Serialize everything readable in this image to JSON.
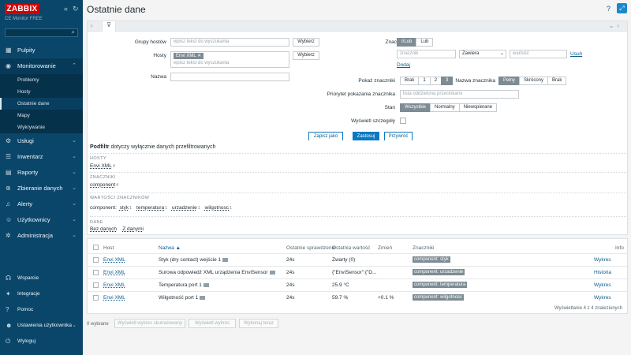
{
  "brand": {
    "logo": "ZABBIX",
    "subtitle": "CE Monitor FREE"
  },
  "sidebar": {
    "items": [
      {
        "label": "Pulpity",
        "icon": "dashboard-icon"
      },
      {
        "label": "Monitorowanie",
        "icon": "eye-icon",
        "open": true
      },
      {
        "label": "Usługi",
        "icon": "services-icon"
      },
      {
        "label": "Inwentarz",
        "icon": "inventory-icon"
      },
      {
        "label": "Raporty",
        "icon": "reports-icon"
      },
      {
        "label": "Zbieranie danych",
        "icon": "data-collection-icon"
      },
      {
        "label": "Alerty",
        "icon": "bell-icon"
      },
      {
        "label": "Użytkownicy",
        "icon": "users-icon"
      },
      {
        "label": "Administracja",
        "icon": "gear-icon"
      }
    ],
    "submenu": [
      {
        "label": "Problemy"
      },
      {
        "label": "Hosty"
      },
      {
        "label": "Ostatnie dane",
        "active": true
      },
      {
        "label": "Mapy"
      },
      {
        "label": "Wykrywanie"
      }
    ],
    "bottom": [
      {
        "label": "Wsparcie"
      },
      {
        "label": "Integracje"
      },
      {
        "label": "Pomoc"
      },
      {
        "label": "Ustawienia użytkownika"
      },
      {
        "label": "Wyloguj"
      }
    ]
  },
  "page": {
    "title": "Ostatnie dane",
    "help": "?"
  },
  "filter": {
    "host_groups_label": "Grupy hostów",
    "host_groups_placeholder": "wpisz tekst do wyszukania",
    "hosts_label": "Hosty",
    "host_chip": "Envi XML",
    "hosts_placeholder": "wpisz tekst do wyszukania",
    "name_label": "Nazwa",
    "select_btn": "Wybierz",
    "tags_label": "Znaczniki",
    "tag_op": [
      "I/Lub",
      "Lub"
    ],
    "tag_placeholder": "znacznik",
    "tag_condition": "Zawiera",
    "tag_value_placeholder": "wartość",
    "remove_link": "Usuń",
    "add_link": "Dodaj",
    "show_tags_label": "Pokaż znaczniki",
    "show_tags_opts": [
      "Brak",
      "1",
      "2",
      "3"
    ],
    "tag_name_label": "Nazwa znacznika",
    "tag_name_opts": [
      "Pełny",
      "Skrócony",
      "Brak"
    ],
    "priority_label": "Priorytet pokazania znacznika",
    "priority_placeholder": "lista oddzielona przecinkami",
    "state_label": "Stan",
    "state_opts": [
      "Wszystkie",
      "Normalny",
      "Niewspierane"
    ],
    "details_label": "Wyświetl szczegóły",
    "save_as": "Zapisz jako",
    "apply": "Zastosuj",
    "reset": "Przywróć"
  },
  "subfilter": {
    "title_bold": "Podfiltr",
    "title_rest": " dotyczy wyłącznie danych przefiltrowanych",
    "hosts_head": "HOSTY",
    "hosts": [
      {
        "name": "Envi XML",
        "count": "4"
      }
    ],
    "tags_head": "ZNACZNIKI",
    "tags": [
      {
        "name": "component",
        "count": "4"
      }
    ],
    "tag_values_head": "WARTOŚCI ZNACZNIKÓW",
    "tag_values_prefix": "component:",
    "tag_values": [
      {
        "name": "styk",
        "count": "1"
      },
      {
        "name": "temperatura",
        "count": "1"
      },
      {
        "name": "urzadzenie",
        "count": "1"
      },
      {
        "name": "wilgotnosc",
        "count": "1"
      }
    ],
    "data_head": "DANE",
    "data": [
      "Bez danych",
      "Z danymi"
    ]
  },
  "table": {
    "headers": {
      "host": "Host",
      "name": "Nazwa ▲",
      "last_check": "Ostatnie sprawdzenie",
      "last_value": "Ostatnia wartość",
      "change": "Zmień",
      "tags": "Znaczniki",
      "info": "Info"
    },
    "rows": [
      {
        "host": "Envi XML",
        "name": "Styk (dry contact) wejście 1",
        "last_check": "24s",
        "last_value": "Zwarty (0)",
        "change": "",
        "tag": "component: styk",
        "action": "Wykres"
      },
      {
        "host": "Envi XML",
        "name": "Surowa odpowiedź XML urządzenia EnviSensor",
        "last_check": "24s",
        "last_value": "{\"EnviSensor\":{\"D...",
        "change": "",
        "tag": "component: urzadzenie",
        "action": "Historia"
      },
      {
        "host": "Envi XML",
        "name": "Temperatura port 1",
        "last_check": "24s",
        "last_value": "25.9 °C",
        "change": "",
        "tag": "component: temperatura",
        "action": "Wykres"
      },
      {
        "host": "Envi XML",
        "name": "Wilgotność port 1",
        "last_check": "24s",
        "last_value": "59.7 %",
        "change": "+0.1 %",
        "tag": "component: wilgotnosc",
        "action": "Wykres"
      }
    ],
    "footer": "Wyświetlanie 4 z 4 znalezionych"
  },
  "bulk": {
    "selected": "0 wybrane",
    "buttons": [
      "Wyświetl wykres skumulowany",
      "Wyświetl wykres",
      "Wykonaj teraz"
    ]
  }
}
